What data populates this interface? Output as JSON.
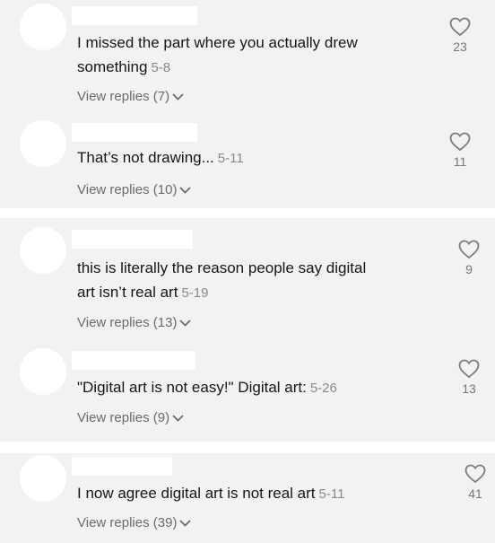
{
  "comments": [
    {
      "text": "I missed the part where you actually drew",
      "text2": "something",
      "date": "5-8",
      "replies": "View replies (7)",
      "likes": "23"
    },
    {
      "text": "That’s not drawing...",
      "date": "5-11",
      "replies": "View replies (10)",
      "likes": "11"
    },
    {
      "text": "this is literally the reason people say digital",
      "text2": "art isn’t real art",
      "date": "5-19",
      "replies": "View replies (13)",
      "likes": "9"
    },
    {
      "text": "\"Digital art is not easy!\" Digital art:",
      "date": "5-26",
      "replies": "View replies (9)",
      "likes": "13"
    },
    {
      "text": "I now agree digital art is not real art",
      "date": "5-11",
      "replies": "View replies (39)",
      "likes": "41"
    }
  ],
  "icons": {
    "like": "heart-outline-icon",
    "expand": "chevron-down-icon"
  }
}
